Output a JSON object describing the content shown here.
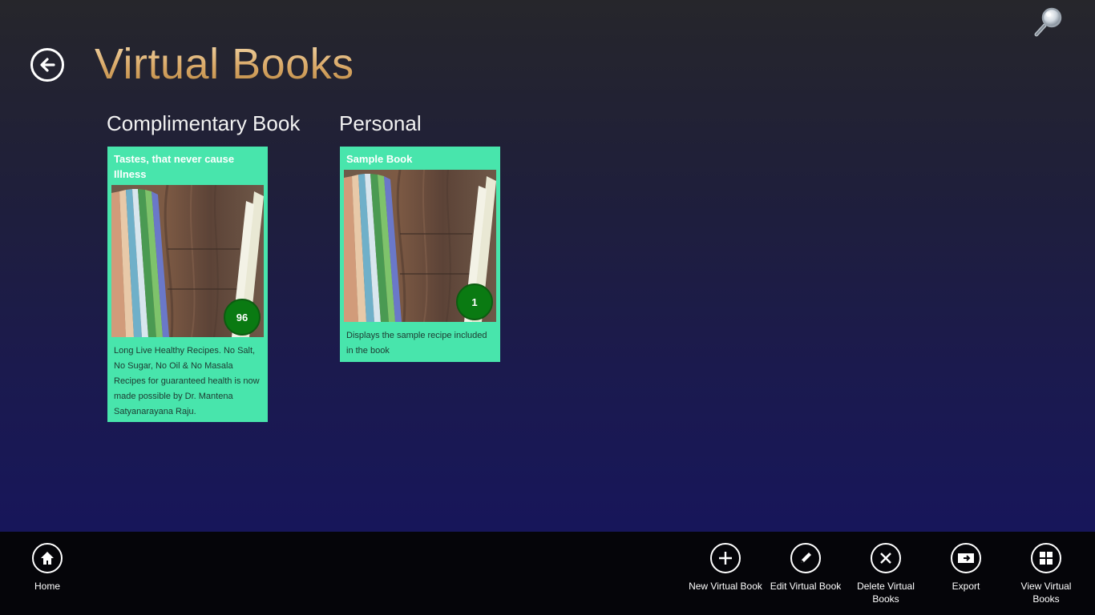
{
  "header": {
    "title": "Virtual Books",
    "back_icon": "back-arrow-icon",
    "search_icon": "magnifier-icon"
  },
  "groups": [
    {
      "name": "Complimentary Book",
      "tile": {
        "title": "Tastes, that never cause Illness",
        "count": "96",
        "description": "Long Live Healthy Recipes. No Salt, No Sugar, No Oil & No Masala Recipes for guaranteed health is now made possible by Dr. Mantena Satyanarayana Raju."
      }
    },
    {
      "name": "Personal",
      "tile": {
        "title": "Sample Book",
        "count": "1",
        "description": "Displays the sample recipe included in the book"
      }
    }
  ],
  "app_bar": {
    "home": "Home",
    "new": "New Virtual Book",
    "edit": "Edit Virtual Book",
    "delete": "Delete Virtual Books",
    "export": "Export",
    "view": "View Virtual Books"
  },
  "colors": {
    "tile_bg": "#48e5ac",
    "badge_bg": "#0a7a12",
    "title_gold": "#d9a866",
    "app_bar_bg": "#050509"
  }
}
